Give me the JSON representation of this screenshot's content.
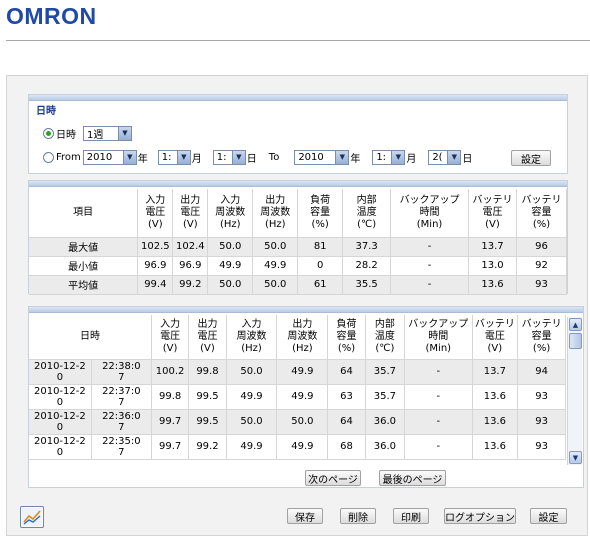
{
  "header": {
    "brand": "OMRON"
  },
  "period": {
    "title": "日時",
    "mode_label_datetime": "日時",
    "range_value": "1週",
    "from_label": "From",
    "from_year": "2010",
    "from_month": "1:",
    "from_day": "1:",
    "unit_year": "年",
    "unit_month": "月",
    "unit_day": "日",
    "to_label": "To",
    "to_year": "2010",
    "to_month": "1:",
    "to_day": "2(",
    "set_button": "設定"
  },
  "summary": {
    "headers": [
      [
        "項目"
      ],
      [
        "入力",
        "電圧",
        "(V)"
      ],
      [
        "出力",
        "電圧",
        "(V)"
      ],
      [
        "入力",
        "周波数",
        "(Hz)"
      ],
      [
        "出力",
        "周波数",
        "(Hz)"
      ],
      [
        "負荷",
        "容量",
        "(%)"
      ],
      [
        "内部",
        "温度",
        "(℃)"
      ],
      [
        "バックアップ",
        "時間",
        "(Min)"
      ],
      [
        "バッテリ",
        "電圧",
        "(V)"
      ],
      [
        "バッテリ",
        "容量",
        "(%)"
      ]
    ],
    "rows": [
      [
        "最大値",
        "102.5",
        "102.4",
        "50.0",
        "50.0",
        "81",
        "37.3",
        "-",
        "13.7",
        "96"
      ],
      [
        "最小値",
        "96.9",
        "96.9",
        "49.9",
        "49.9",
        "0",
        "28.2",
        "-",
        "13.0",
        "92"
      ],
      [
        "平均値",
        "99.4",
        "99.2",
        "50.0",
        "50.0",
        "61",
        "35.5",
        "-",
        "13.6",
        "93"
      ]
    ]
  },
  "log": {
    "headers": [
      [
        "日時"
      ],
      [
        "入力",
        "電圧",
        "(V)"
      ],
      [
        "出力",
        "電圧",
        "(V)"
      ],
      [
        "入力",
        "周波数",
        "(Hz)"
      ],
      [
        "出力",
        "周波数",
        "(Hz)"
      ],
      [
        "負荷",
        "容量",
        "(%)"
      ],
      [
        "内部",
        "温度",
        "(℃)"
      ],
      [
        "バックアップ",
        "時間",
        "(Min)"
      ],
      [
        "バッテリ",
        "電圧",
        "(V)"
      ],
      [
        "バッテリ",
        "容量",
        "(%)"
      ]
    ],
    "rows": [
      [
        [
          "2010-12-2",
          "0"
        ],
        [
          "22:38:0",
          "7"
        ],
        "100.2",
        "99.8",
        "50.0",
        "49.9",
        "64",
        "35.7",
        "-",
        "13.7",
        "94"
      ],
      [
        [
          "2010-12-2",
          "0"
        ],
        [
          "22:37:0",
          "7"
        ],
        "99.8",
        "99.5",
        "49.9",
        "49.9",
        "63",
        "35.7",
        "-",
        "13.6",
        "93"
      ],
      [
        [
          "2010-12-2",
          "0"
        ],
        [
          "22:36:0",
          "7"
        ],
        "99.7",
        "99.5",
        "50.0",
        "50.0",
        "64",
        "36.0",
        "-",
        "13.6",
        "93"
      ],
      [
        [
          "2010-12-2",
          "0"
        ],
        [
          "22:35:0",
          "7"
        ],
        "99.7",
        "99.2",
        "49.9",
        "49.9",
        "68",
        "36.0",
        "-",
        "13.6",
        "93"
      ]
    ],
    "next_page": "次のページ",
    "last_page": "最後のページ"
  },
  "footer": {
    "save": "保存",
    "delete": "削除",
    "print": "印刷",
    "log_option": "ログオプション",
    "settings": "設定"
  },
  "colors": {
    "brand": "#1f4aa8",
    "section_title": "#1a3a8a",
    "radio_on": "#2d9c2d"
  },
  "icons": {
    "chart_button": "line-chart-icon",
    "scroll_up": "scroll-up-icon",
    "scroll_down": "scroll-down-icon"
  }
}
